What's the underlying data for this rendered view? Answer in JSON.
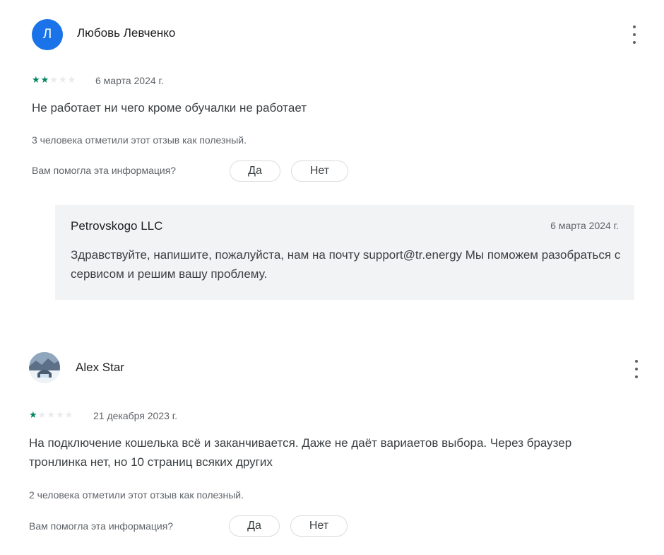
{
  "reviews": [
    {
      "avatar_letter": "Л",
      "author": "Любовь Левченко",
      "rating": 2,
      "date": "6 марта 2024 г.",
      "text": "Не работает ни чего кроме обучалки не работает",
      "helpful_text": "3 человека отметили этот отзыв как полезный.",
      "ask": "Вам помогла эта информация?",
      "yes": "Да",
      "no": "Нет",
      "reply": {
        "name": "Petrovskogo LLC",
        "date": "6 марта 2024 г.",
        "text": "Здравствуйте, напишите, пожалуйста, нам на почту support@tr.energy Мы поможем разобраться с сервисом и решим вашу проблему."
      }
    },
    {
      "author": "Alex Star",
      "rating": 1,
      "date": "21 декабря 2023 г.",
      "text": "На подключение кошелька всё и заканчивается. Даже не даёт вариаетов выбора. Через браузер тронлинка нет, но 10 страниц всяких других",
      "helpful_text": "2 человека отметили этот отзыв как полезный.",
      "ask": "Вам помогла эта информация?",
      "yes": "Да",
      "no": "Нет"
    }
  ],
  "colors": {
    "star_on": "#01875f",
    "star_off": "#e8eaed",
    "avatar": "#1a73e8",
    "reply_bg": "#f1f3f4"
  },
  "icons": {
    "more": "more-vert-icon",
    "star": "star-icon"
  }
}
